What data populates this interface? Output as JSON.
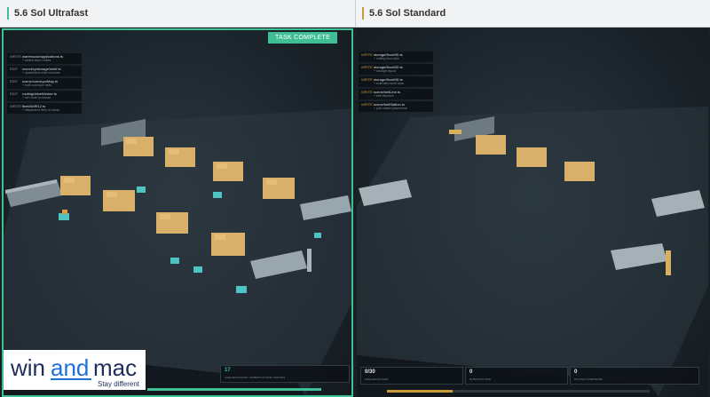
{
  "header": {
    "left_title": "5.6 Sol Ultrafast",
    "right_title": "5.6 Sol Standard"
  },
  "left_panel": {
    "badge": "TASK COMPLETE",
    "log": [
      {
        "action": "WRITE",
        "file": "warehouse/applications.ts",
        "detail": "+ added store routes"
      },
      {
        "action": "EDIT",
        "file": "recovery/storage/shelf.ts",
        "detail": "+ assembled shelf modules"
      },
      {
        "action": "EDIT",
        "file": "scene/conveyorMap.ts",
        "detail": "+ built conveyor belts"
      },
      {
        "action": "EDIT",
        "file": "routing/driveWorker.ts",
        "detail": "+ set route to unload"
      },
      {
        "action": "WRITE",
        "file": "fleet/AMR12.ts",
        "detail": "+ dispatched fleet of robots"
      }
    ],
    "stats": [
      {
        "value": "17",
        "label": "SHELVES PLACED / ROBOTS ACTIVE / ROUTES"
      },
      {
        "value": "",
        "label": ""
      }
    ],
    "progress": 1.0,
    "progress_color": "#3fbf95"
  },
  "right_panel": {
    "log": [
      {
        "action": "WRITE",
        "file": "storage/floorMD.ts",
        "detail": "+ setting floor plan"
      },
      {
        "action": "WRITE",
        "file": "storage/floorMD.ts",
        "detail": "+ storage layout"
      },
      {
        "action": "WRITE",
        "file": "storage/floorMD.ts",
        "detail": "+ extended shelf rows"
      },
      {
        "action": "WRITE",
        "file": "scene/beltLine.ts",
        "detail": "+ belt direction"
      },
      {
        "action": "WRITE",
        "file": "scene/beltStation.ts",
        "detail": "+ pick station placement"
      }
    ],
    "stats": [
      {
        "value": "0/30",
        "label": "SHELVES PLACED"
      },
      {
        "value": "0",
        "label": "ROBOTS ACTIVE"
      },
      {
        "value": "0",
        "label": "ROUTES COMPLETED"
      }
    ],
    "progress": 0.25,
    "progress_color": "#c79a3a"
  },
  "logo": {
    "brand_a": "win",
    "brand_b": "and",
    "brand_c": "mac",
    "tagline": "Stay different",
    "brand_color": "#1d2d5c",
    "accent_color": "#1e6fd9"
  }
}
